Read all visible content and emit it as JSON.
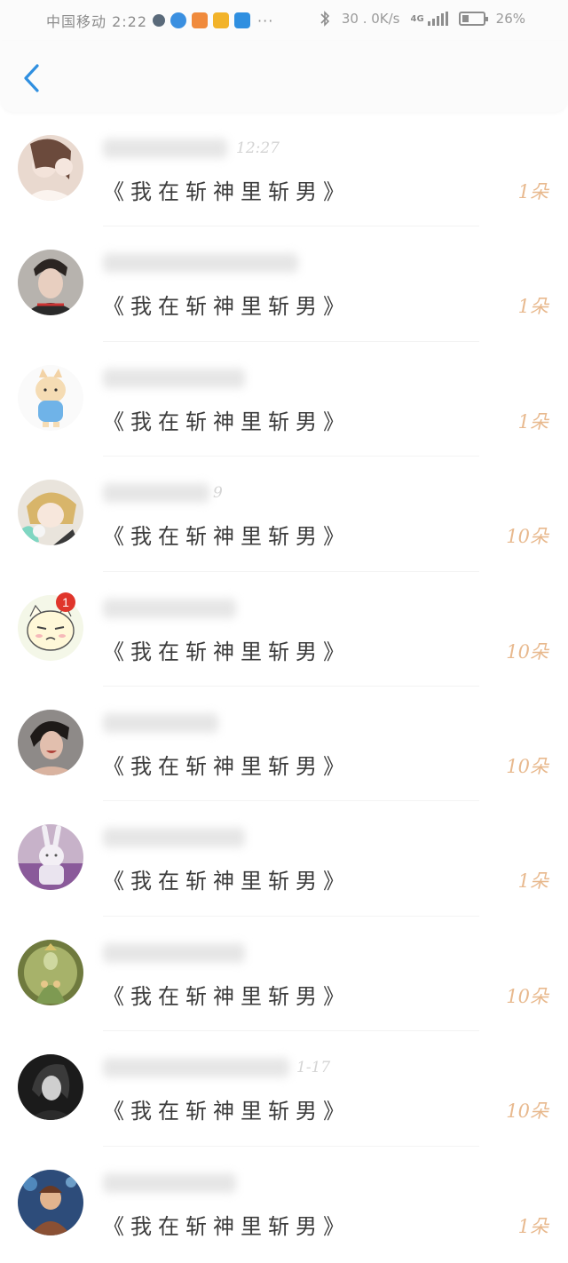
{
  "status_bar": {
    "carrier_time": "中国移动 2:22",
    "app_icon_colors": [
      "#5a6a7a",
      "#3a8fe0",
      "#f08a3c",
      "#f2b32a",
      "#2f8fe0"
    ],
    "dots": "···",
    "network_speed": "30 . 0K/s",
    "network_type": "4G",
    "battery": "26%"
  },
  "header": {
    "back_icon": "chevron-left-icon",
    "accent": "#2f8fe0"
  },
  "list": {
    "items": [
      {
        "time": "12:27",
        "title": "《我在斩神里斩男》",
        "count": "1朵",
        "badge": ""
      },
      {
        "time": "",
        "title": "《我在斩神里斩男》",
        "count": "1朵",
        "badge": ""
      },
      {
        "time": "",
        "title": "《我在斩神里斩男》",
        "count": "1朵",
        "badge": ""
      },
      {
        "time": "9",
        "title": "《我在斩神里斩男》",
        "count": "10朵",
        "badge": ""
      },
      {
        "time": "",
        "title": "《我在斩神里斩男》",
        "count": "10朵",
        "badge": "1"
      },
      {
        "time": "",
        "title": "《我在斩神里斩男》",
        "count": "10朵",
        "badge": ""
      },
      {
        "time": "",
        "title": "《我在斩神里斩男》",
        "count": "1朵",
        "badge": ""
      },
      {
        "time": "",
        "title": "《我在斩神里斩男》",
        "count": "10朵",
        "badge": ""
      },
      {
        "time": "1-17",
        "title": "《我在斩神里斩男》",
        "count": "10朵",
        "badge": ""
      },
      {
        "time": "",
        "title": "《我在斩神里斩男》",
        "count": "1朵",
        "badge": ""
      }
    ]
  }
}
